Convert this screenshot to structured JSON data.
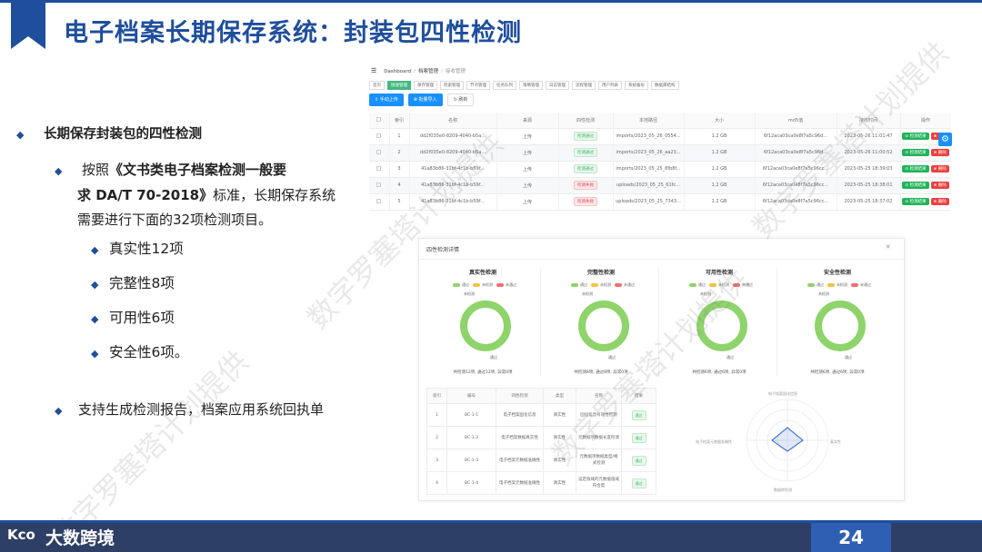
{
  "slide": {
    "title": "电子档案长期保存系统：封装包四性检测",
    "page_number": "24",
    "brand_mark": "Kco",
    "brand_name": "大数跨境",
    "accent": "#1f4e9c"
  },
  "bullets": {
    "level1": "长期保存封装包的四性检测",
    "level2_prefix": "按照",
    "level2_bold1": "《文书类电子档案检测一般要",
    "level2_bold2": "求 DA/T 70-2018》",
    "level2_rest1": "标准，长期保存系统",
    "level2_rest2": "需要进行下面的32项检测项目。",
    "items": [
      "真实性12项",
      "完整性8项",
      "可用性6项",
      "安全性6项。"
    ],
    "last": "支持生成检测报告，档案应用系统回执单"
  },
  "watermarks": [
    "数字罗塞塔计划提供",
    "数字罗塞塔计划提供",
    "数字罗塞塔计划提供",
    "数字罗塞塔计划提供"
  ],
  "app": {
    "breadcrumb": [
      "Dashboard",
      "档案管理",
      "接收管理"
    ],
    "tabs": [
      "首页",
      "接收管理",
      "保存管理",
      "检索管理",
      "节点管理",
      "任务队列",
      "策略管理",
      "日志管理",
      "流程管理",
      "用户列表",
      "系统备份",
      "数据库结构"
    ],
    "buttons": {
      "upload": "⇧ 手动上传",
      "batch": "⊕ 批量导入",
      "refresh": "↻ 刷新"
    },
    "columns": [
      "",
      "索引",
      "名称",
      "来源",
      "四性检测",
      "本地路径",
      "大小",
      "md5值",
      "接收时间",
      "操作"
    ],
    "rows": [
      [
        "1",
        "dd2f035e0-8209-4040-b5a...",
        "上传",
        "检测通过",
        "imports/2023_05_26_0554...",
        "1.2 GB",
        "6f12aca03ca0e8f7a5c96d...",
        "2023-05-26 11:01:47"
      ],
      [
        "2",
        "dd2f035e0-8209-4040-b5a...",
        "上传",
        "检测通过",
        "imports/2023_05_26_aa23...",
        "1.2 GB",
        "6f12aca03ca0e8f7a5c96d...",
        "2023-05-26 11:00:52"
      ],
      [
        "3",
        "41a83b86-31bf-4c1b-b59f...",
        "上传",
        "检测通过",
        "imports/2023_05_25_8fb8f...",
        "1.2 GB",
        "6f12aca03ca0e8f7a5c96cc...",
        "2023-05-25 18:39:03"
      ],
      [
        "4",
        "41a83b86-31bf-4c1b-b59f...",
        "上传",
        "检测失败",
        "uploads/2023_05_25_61fc...",
        "1.2 GB",
        "6f12aca03ca0e8f7a5c96cc...",
        "2023-05-25 18:38:01"
      ],
      [
        "5",
        "41a83b86-31bf-4c1b-b59f...",
        "上传",
        "检测失败",
        "uploads/2023_05_25_7343...",
        "1.2 GB",
        "6f12aca03ca0e8f7a5c96cc...",
        "2023-05-25 18:37:02"
      ]
    ],
    "action_view": "⊙ 检测结果",
    "action_delete": "⊗ 删除"
  },
  "dialog": {
    "title": "四性检测详情",
    "close": "×",
    "legend": [
      "通过",
      "未检测",
      "未通过"
    ],
    "legend_colors": [
      "#8fd36b",
      "#f5c242",
      "#f07070"
    ],
    "label_top": "未检测",
    "label_bottom": "通过",
    "panels": [
      {
        "title": "真实性检测",
        "summary": "共检测12项, 通过12项, 异常0项"
      },
      {
        "title": "完整性检测",
        "summary": "共检测8项, 通过8项, 异常0项"
      },
      {
        "title": "可用性检测",
        "summary": "共检测6项, 通过6项, 异常0项"
      },
      {
        "title": "安全性检测",
        "summary": "共检测6项, 通过6项, 异常0项"
      }
    ],
    "table_columns": [
      "索引",
      "编号",
      "四性检测",
      "类型",
      "名称",
      "结果"
    ],
    "table_rows": [
      [
        "1",
        "BC-1-1",
        "电子档案固化信息",
        "真实性",
        "固化信息有效性检测",
        "通过"
      ],
      [
        "2",
        "BC-1-2",
        "电子档案数据真实性",
        "真实性",
        "元数据项数据长度检测",
        "通过"
      ],
      [
        "3",
        "BC-1-3",
        "电子档案元数据准确性",
        "真实性",
        "元数据项数据类型/格式检测",
        "通过"
      ],
      [
        "4",
        "BC-1-4",
        "电子档案元数据准确性",
        "真实性",
        "设定值域的元数据值域符合度",
        "通过"
      ]
    ],
    "radar_labels": [
      "电子档案固化信息",
      "真实性",
      "数据库检测",
      "电子档案元数据准确性"
    ]
  }
}
